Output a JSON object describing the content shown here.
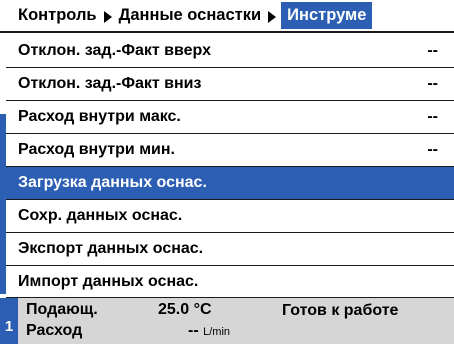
{
  "breadcrumb": {
    "items": [
      "Контроль",
      "Данные оснастки",
      "Инструме"
    ]
  },
  "menu": {
    "items": [
      {
        "label": "Отклон. зад.-Факт вверх",
        "value": "--"
      },
      {
        "label": "Отклон. зад.-Факт вниз",
        "value": "--"
      },
      {
        "label": "Расход внутри макс.",
        "value": "--"
      },
      {
        "label": "Расход внутри мин.",
        "value": "--"
      },
      {
        "label": "Загрузка данных оснас.",
        "value": ""
      },
      {
        "label": "Сохр. данных оснас.",
        "value": ""
      },
      {
        "label": "Экспорт данных оснас.",
        "value": ""
      },
      {
        "label": "Импорт данных оснас.",
        "value": ""
      }
    ],
    "selected_label": "Загрузка данных оснас."
  },
  "status": {
    "station_number": "1",
    "supply_label": "Подающ.",
    "supply_value": "25.0 °C",
    "flow_label": "Расход",
    "flow_value": "--",
    "flow_unit": "L/min",
    "state_text": "Готов к работе"
  },
  "colors": {
    "accent": "#2c5fb3",
    "status_bg": "#d6d6d6",
    "text": "#000000"
  }
}
